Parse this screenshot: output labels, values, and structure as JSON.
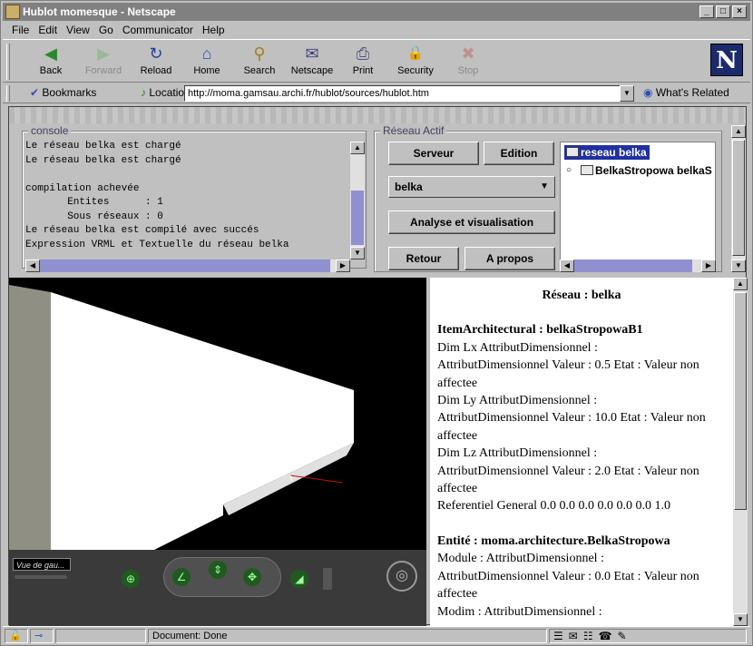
{
  "window": {
    "title": "Hublot momesque - Netscape",
    "min": "_",
    "max": "□",
    "close": "×"
  },
  "menu": [
    "File",
    "Edit",
    "View",
    "Go",
    "Communicator",
    "Help"
  ],
  "toolbar": [
    {
      "label": "Back",
      "icon": "back-arrow-icon",
      "glyph": "◀",
      "enabled": true
    },
    {
      "label": "Forward",
      "icon": "forward-arrow-icon",
      "glyph": "▶",
      "enabled": false
    },
    {
      "label": "Reload",
      "icon": "reload-icon",
      "glyph": "↻",
      "enabled": true
    },
    {
      "label": "Home",
      "icon": "home-icon",
      "glyph": "⌂",
      "enabled": true
    },
    {
      "label": "Search",
      "icon": "search-icon",
      "glyph": "⚲",
      "enabled": true
    },
    {
      "label": "Netscape",
      "icon": "my-netscape-icon",
      "glyph": "✉",
      "enabled": true
    },
    {
      "label": "Print",
      "icon": "print-icon",
      "glyph": "⎙",
      "enabled": true
    },
    {
      "label": "Security",
      "icon": "lock-icon",
      "glyph": "🔒",
      "enabled": true
    },
    {
      "label": "Stop",
      "icon": "stop-icon",
      "glyph": "✖",
      "enabled": false
    }
  ],
  "locationbar": {
    "bookmarks": "Bookmarks",
    "location_label": "Location:",
    "url": "http://moma.gamsau.archi.fr/hublot/sources/hublot.htm",
    "whats_related": "What's Related"
  },
  "console": {
    "legend": "console",
    "lines": "Le réseau belka est chargé\nLe réseau belka est chargé\n\ncompilation achevée\n       Entites      : 1\n       Sous réseaux : 0\nLe réseau belka est compilé avec succés\nExpression VRML et Textuelle du réseau belka"
  },
  "reseau": {
    "legend": "Réseau Actif",
    "serveur": "Serveur",
    "edition": "Edition",
    "selected": "belka",
    "analyse": "Analyse et visualisation",
    "retour": "Retour",
    "apropos": "A propos",
    "tree_root": "reseau belka",
    "tree_child": "BelkaStropowa belkaS"
  },
  "viewer": {
    "view_label": "Vue de gau..."
  },
  "info": {
    "title": "Réseau : belka",
    "item_heading": "ItemArchitectural : belkaStropowaB1",
    "item_lines": [
      "Dim Lx AttributDimensionnel :",
      "AttributDimensionnel Valeur : 0.5 Etat : Valeur non affectee",
      "Dim Ly AttributDimensionnel :",
      "AttributDimensionnel Valeur : 10.0 Etat : Valeur non affectee",
      "Dim Lz AttributDimensionnel :",
      "AttributDimensionnel Valeur : 2.0 Etat : Valeur non affectee",
      "Referentiel General 0.0 0.0 0.0 0.0 0.0 0.0 1.0"
    ],
    "entity_heading": "Entité : moma.architecture.BelkaStropowa",
    "entity_lines": [
      "Module : AttributDimensionnel :",
      "AttributDimensionnel Valeur : 0.0 Etat : Valeur non affectee",
      "Modim : AttributDimensionnel :"
    ]
  },
  "status": {
    "text": "Document: Done"
  }
}
